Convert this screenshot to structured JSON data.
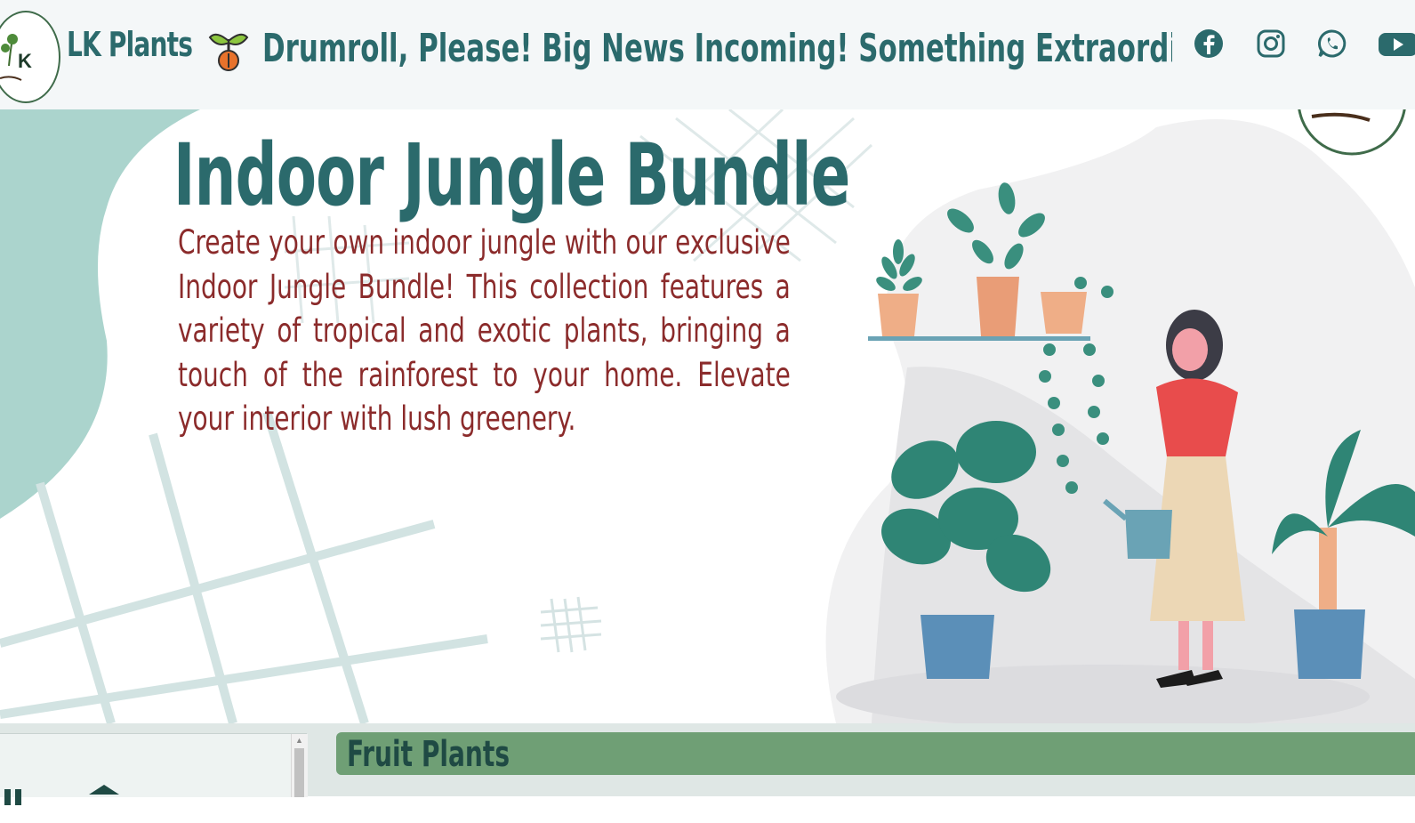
{
  "header": {
    "brand": "LK Plants",
    "logo_letter": "K",
    "announcement": "Drumroll, Please! Big News Incoming! Something Extraordinary Is Sprouting",
    "social": [
      {
        "name": "facebook-icon",
        "color": "#2b6a6c"
      },
      {
        "name": "instagram-icon",
        "color": "#2b6a6c"
      },
      {
        "name": "whatsapp-icon",
        "color": "#2b6a6c"
      },
      {
        "name": "youtube-icon",
        "color": "#2b6a6c"
      }
    ]
  },
  "hero": {
    "title": "Indoor Jungle Bundle",
    "description": "Create your own indoor jungle with our exclusive Indoor Jungle Bundle! This collection features a variety of tropical and exotic plants, bringing a touch of the rainforest to your home. Elevate your interior with lush greenery."
  },
  "category": {
    "title": "Fruit Plants"
  },
  "colors": {
    "brand": "#2b6a6c",
    "text_accent": "#8b2b2b",
    "category_bar": "#6f9f75"
  }
}
